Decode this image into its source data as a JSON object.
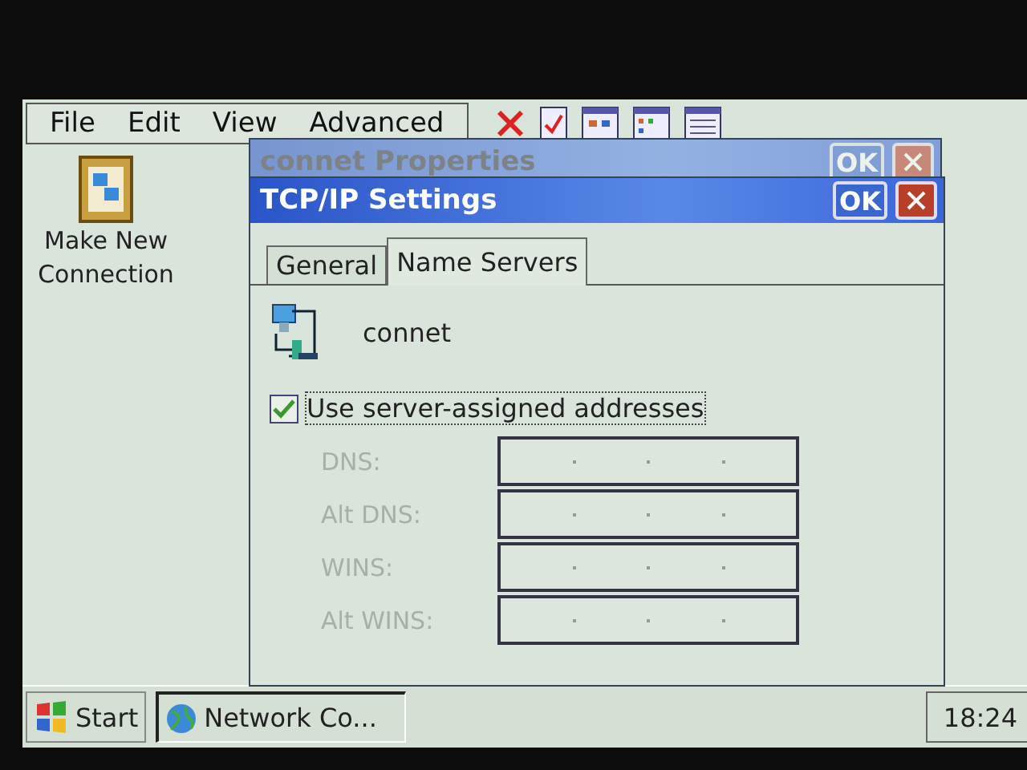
{
  "menu": [
    {
      "label": "File"
    },
    {
      "label": "Edit"
    },
    {
      "label": "View"
    },
    {
      "label": "Advanced"
    }
  ],
  "desktop_icons": [
    {
      "label": "Make New Connection"
    }
  ],
  "back_window": {
    "title": "connet Properties",
    "ok": "OK"
  },
  "dialog": {
    "title": "TCP/IP Settings",
    "ok": "OK",
    "tabs": [
      {
        "label": "General",
        "selected": false
      },
      {
        "label": "Name Servers",
        "selected": true
      }
    ],
    "connection_name": "connet",
    "checkbox": {
      "label": "Use server-assigned addresses",
      "checked": true
    },
    "fields": [
      {
        "label": "DNS:",
        "disabled": true
      },
      {
        "label": "Alt DNS:",
        "disabled": true
      },
      {
        "label": "WINS:",
        "disabled": true
      },
      {
        "label": "Alt WINS:",
        "disabled": true
      }
    ]
  },
  "taskbar": {
    "start": "Start",
    "tasks": [
      {
        "label": "Network Co...",
        "selected": true
      }
    ],
    "clock": "18:24"
  }
}
